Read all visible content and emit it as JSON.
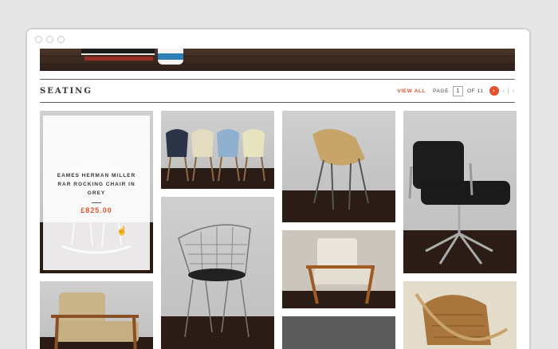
{
  "section": {
    "title": "SEATING",
    "view_all": "VIEW ALL",
    "page_label": "PAGE",
    "page_current": "1",
    "page_of": "OF 11",
    "next_glyph": "›",
    "nav_glyphs": "‹ | ›"
  },
  "featured_product": {
    "name": "EAMES HERMAN MILLER RAR ROCKING CHAIR IN GREY",
    "price": "£825.00"
  },
  "colors": {
    "accent": "#e0532d"
  },
  "icons": [
    "pointer-hand-cursor-icon",
    "next-arrow-icon"
  ]
}
